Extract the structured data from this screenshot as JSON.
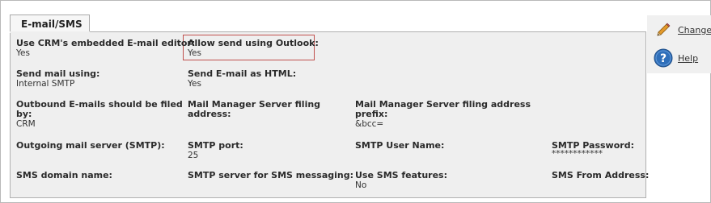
{
  "tab": {
    "label": "E-mail/SMS"
  },
  "fields": {
    "embedded_editor": {
      "label": "Use CRM's embedded E-mail editor:",
      "value": "Yes"
    },
    "allow_outlook": {
      "label": "Allow send using Outlook:",
      "value": "Yes"
    },
    "send_mail_using": {
      "label": "Send mail using:",
      "value": "Internal SMTP"
    },
    "send_as_html": {
      "label": "Send E-mail as HTML:",
      "value": "Yes"
    },
    "outbound_filed_by_l1": {
      "label": "Outbound E-mails should be filed"
    },
    "outbound_filed_by_l2": {
      "label": "by:",
      "value": "CRM"
    },
    "mms_filing_address_l1": {
      "label": "Mail Manager Server filing"
    },
    "mms_filing_address_l2": {
      "label": "address:"
    },
    "mms_filing_prefix_l1": {
      "label": "Mail Manager Server filing address"
    },
    "mms_filing_prefix_l2": {
      "label": "prefix:",
      "value": "&bcc="
    },
    "outgoing_server": {
      "label": "Outgoing mail server (SMTP):"
    },
    "smtp_port": {
      "label": "SMTP port:",
      "value": "25"
    },
    "smtp_user": {
      "label": "SMTP User Name:"
    },
    "smtp_password": {
      "label": "SMTP Password:",
      "value": "************"
    },
    "sms_domain": {
      "label": "SMS domain name:"
    },
    "smtp_sms_server": {
      "label": "SMTP server for SMS messaging:"
    },
    "use_sms": {
      "label": "Use SMS features:",
      "value": "No"
    },
    "sms_from": {
      "label": "SMS From Address:"
    }
  },
  "side": {
    "change_label": "Change",
    "help_label": "Help"
  },
  "colors": {
    "highlight_border": "#c0504d",
    "panel_bg": "#efefef",
    "help_icon_blue": "#2f6fba",
    "pencil_orange": "#e39a2b"
  }
}
